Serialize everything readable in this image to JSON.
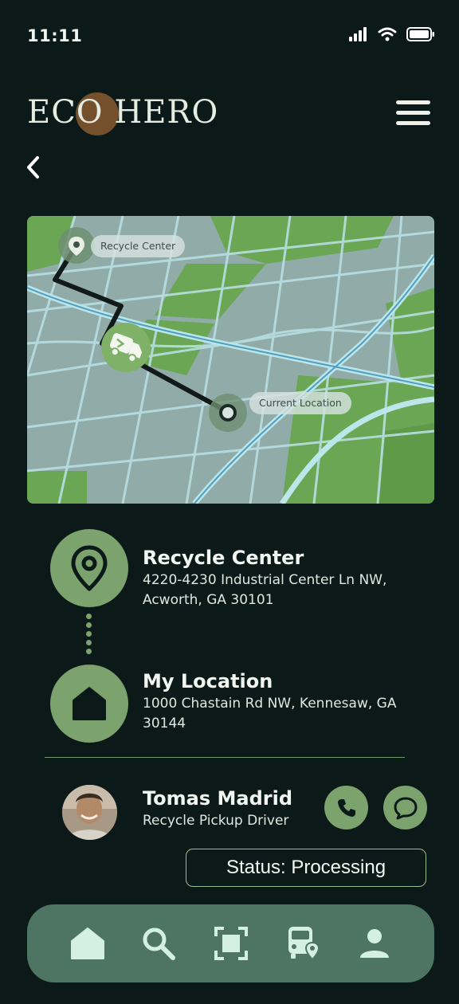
{
  "status_bar": {
    "time": "11:11"
  },
  "header": {
    "logo_text": "ECO HERO"
  },
  "map": {
    "labels": {
      "destination": "Recycle Center",
      "origin": "Current Location"
    }
  },
  "locations": [
    {
      "title": "Recycle Center",
      "address": "4220-4230 Industrial Center Ln NW, Acworth, GA 30101",
      "icon": "map-pin-icon"
    },
    {
      "title": "My Location",
      "address": "1000 Chastain Rd NW, Kennesaw, GA 30144",
      "icon": "home-icon"
    }
  ],
  "driver": {
    "name": "Tomas Madrid",
    "role": "Recycle Pickup Driver"
  },
  "status": {
    "text": "Status: Processing"
  },
  "nav": [
    "home-icon",
    "search-icon",
    "scan-icon",
    "bus-location-icon",
    "profile-icon"
  ],
  "colors": {
    "background": "#0b1a18",
    "accent": "#7ca26e",
    "nav": "#4e7464",
    "map_park": "#6aa653",
    "map_base": "#90aba8",
    "road": "#bde6ea"
  }
}
